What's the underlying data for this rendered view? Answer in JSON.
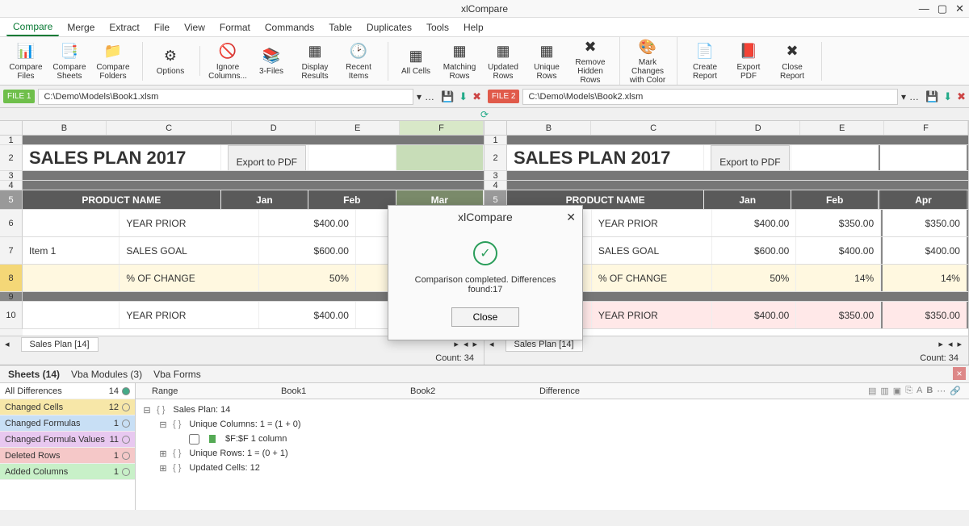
{
  "app": {
    "title": "xlCompare"
  },
  "menu": [
    "Compare",
    "Merge",
    "Extract",
    "File",
    "View",
    "Format",
    "Commands",
    "Table",
    "Duplicates",
    "Tools",
    "Help"
  ],
  "ribbon": [
    {
      "icon": "📊",
      "label": "Compare\nFiles"
    },
    {
      "icon": "📑",
      "label": "Compare\nSheets"
    },
    {
      "icon": "📁",
      "label": "Compare\nFolders"
    },
    {
      "icon": "⚙",
      "label": "Options"
    },
    {
      "icon": "🚫",
      "label": "Ignore\nColumns..."
    },
    {
      "icon": "📚",
      "label": "3-Files"
    },
    {
      "icon": "▦",
      "label": "Display\nResults"
    },
    {
      "icon": "🕑",
      "label": "Recent\nItems"
    },
    {
      "icon": "▦",
      "label": "All Cells"
    },
    {
      "icon": "▦",
      "label": "Matching\nRows"
    },
    {
      "icon": "▦",
      "label": "Updated\nRows"
    },
    {
      "icon": "▦",
      "label": "Unique\nRows"
    },
    {
      "icon": "✖",
      "label": "Remove\nHidden Rows"
    },
    {
      "icon": "🎨",
      "label": "Mark Changes\nwith Color"
    },
    {
      "icon": "📄",
      "label": "Create\nReport"
    },
    {
      "icon": "📕",
      "label": "Export\nPDF"
    },
    {
      "icon": "✖",
      "label": "Close\nReport"
    }
  ],
  "files": {
    "left": {
      "tag": "FILE 1",
      "path": "C:\\Demo\\Models\\Book1.xlsm"
    },
    "right": {
      "tag": "FILE 2",
      "path": "C:\\Demo\\Models\\Book2.xlsm"
    }
  },
  "sheet": {
    "colsLeft": [
      "B",
      "C",
      "D",
      "E",
      "F"
    ],
    "colsRight": [
      "B",
      "C",
      "D",
      "E",
      "F"
    ],
    "titleLeft": "SALES PLAN 2017",
    "titleRight": "SALES PLAN 2017",
    "exportBtn": "Export to PDF",
    "header": {
      "prod": "PRODUCT NAME",
      "m1l": "Jan",
      "m2l": "Feb",
      "m3l": "Mar",
      "m1r": "Jan",
      "m2r": "Feb",
      "m3r": "Apr"
    },
    "rows": [
      {
        "label": "YEAR PRIOR",
        "v1": "$400.00",
        "v2": "$35",
        "r1": "$400.00",
        "r2": "$350.00",
        "r3": "$350.00"
      },
      {
        "label": "SALES GOAL",
        "v1": "$600.00",
        "v2": "$4",
        "r1": "$600.00",
        "r2": "$400.00",
        "r3": "$400.00"
      },
      {
        "label": "% OF CHANGE",
        "v1": "50%",
        "v2": "",
        "r1": "50%",
        "r2": "14%",
        "r3": "14%"
      },
      {
        "label": "YEAR PRIOR",
        "v1": "$400.00",
        "v2": "",
        "r1": "$400.00",
        "r2": "$350.00",
        "r3": "$350.00"
      }
    ],
    "item": "Item 1",
    "tab": "Sales Plan [14]",
    "count": "Count: 34"
  },
  "diff": {
    "tabs": {
      "sheets": "Sheets (14)",
      "vba": "Vba Modules (3)",
      "forms": "Vba Forms"
    },
    "filters": [
      {
        "label": "All Differences",
        "count": "14",
        "cls": "",
        "on": true
      },
      {
        "label": "Changed Cells",
        "count": "12",
        "cls": "bg-y"
      },
      {
        "label": "Changed Formulas",
        "count": "1",
        "cls": "bg-b"
      },
      {
        "label": "Changed Formula Values",
        "count": "11",
        "cls": "bg-p"
      },
      {
        "label": "Deleted Rows",
        "count": "1",
        "cls": "bg-r"
      },
      {
        "label": "Added Columns",
        "count": "1",
        "cls": "bg-g"
      }
    ],
    "cols": [
      "Range",
      "Book1",
      "Book2",
      "Difference"
    ],
    "tree": [
      {
        "exp": "⊟",
        "lvl": 0,
        "text": "Sales Plan: 14"
      },
      {
        "exp": "⊟",
        "lvl": 1,
        "text": "Unique Columns: 1 = (1 + 0)"
      },
      {
        "exp": "",
        "lvl": 2,
        "text": "$F:$F      1 column",
        "chk": true
      },
      {
        "exp": "⊞",
        "lvl": 1,
        "text": "Unique Rows: 1 = (0 + 1)"
      },
      {
        "exp": "⊞",
        "lvl": 1,
        "text": "Updated Cells: 12"
      }
    ]
  },
  "modal": {
    "title": "xlCompare",
    "msg": "Comparison completed. Differences found:17",
    "btn": "Close"
  }
}
